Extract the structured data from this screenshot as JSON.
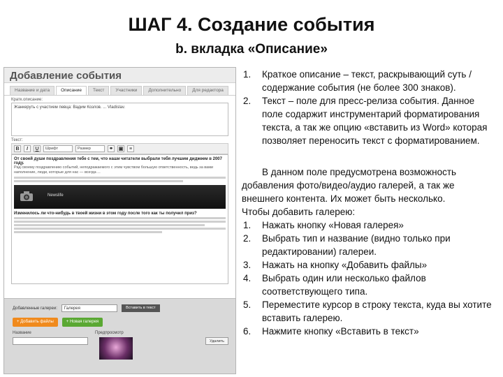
{
  "title": "ШАГ 4. Создание события",
  "subtitle": "b. вкладка «Описание»",
  "screenshot": {
    "header": "Добавление события",
    "tabs": [
      "Название и дата",
      "Описание",
      "Текст",
      "Участники",
      "Дополнительно",
      "Для редактора"
    ],
    "short_desc_label": "Кратк.описание:",
    "short_desc_text": "Жанкеруть с участием певца: Вадим Козлов. ... Vladislav.",
    "text_label": "Текст:",
    "font_select": "Шрифт",
    "size_select": "Размер",
    "editor_heading": "От своей души поздравления тебе с тем, что наши читатели выбрали тебя лучшим диджеем в 2007 году.",
    "editor_body": "Рад своему поздравлению событий, неподражаемого с этим чувством большую ответственность, ведь за вами наполнение, люди, которые для нас — всегда ...",
    "video_caption": "Newslife",
    "editor_subhead": "Изменилось ли что-нибудь в твоей жизни в этом году после того как ты получил приз?",
    "gallery_label": "Добавленные галереи:",
    "gallery_select": "Галерея",
    "gallery_button": "Вставить в текст",
    "add_files_button": "+ Добавить файлы",
    "new_gallery_button": "+ Новая галерея",
    "col_name": "Название",
    "col_preview": "Предпросмотр",
    "delete_button": "Удалить"
  },
  "right": {
    "list1": [
      {
        "num": "1.",
        "text": "Краткое описание – текст, раскрывающий суть / содержание события (не более 300 знаков)."
      },
      {
        "num": "2.",
        "text": "Текст – поле для пресс-релиза события. Данное поле содаржит инструментарий форматирования текста, а так же опцию «вставить из Word» которая позволяет переносить текст с форматированием."
      }
    ],
    "paragraph": "В данном поле предусмотрена возможность добавления фото/видео/аудио галерей, а так же внешнего контента. Их может быть несколько.",
    "how_to": "Чтобы добавить галерею:",
    "list2": [
      {
        "num": "1.",
        "text": "Нажать кнопку «Новая галерея»"
      },
      {
        "num": "2.",
        "text": "Выбрать тип и название (видно только при редактировании) галереи."
      },
      {
        "num": "3.",
        "text": "Нажать на кнопку «Добавить файлы»"
      },
      {
        "num": "4.",
        "text": "Выбрать один или несколько файлов соответствующего типа."
      },
      {
        "num": "5.",
        "text": "Переместите курсор в строку текста, куда вы хотите вставить галерею."
      },
      {
        "num": "6.",
        "text": "Нажмите кнопку «Вставить в текст»"
      }
    ]
  },
  "colors": {
    "orange": "#f08a1d",
    "green": "#5aa833"
  }
}
